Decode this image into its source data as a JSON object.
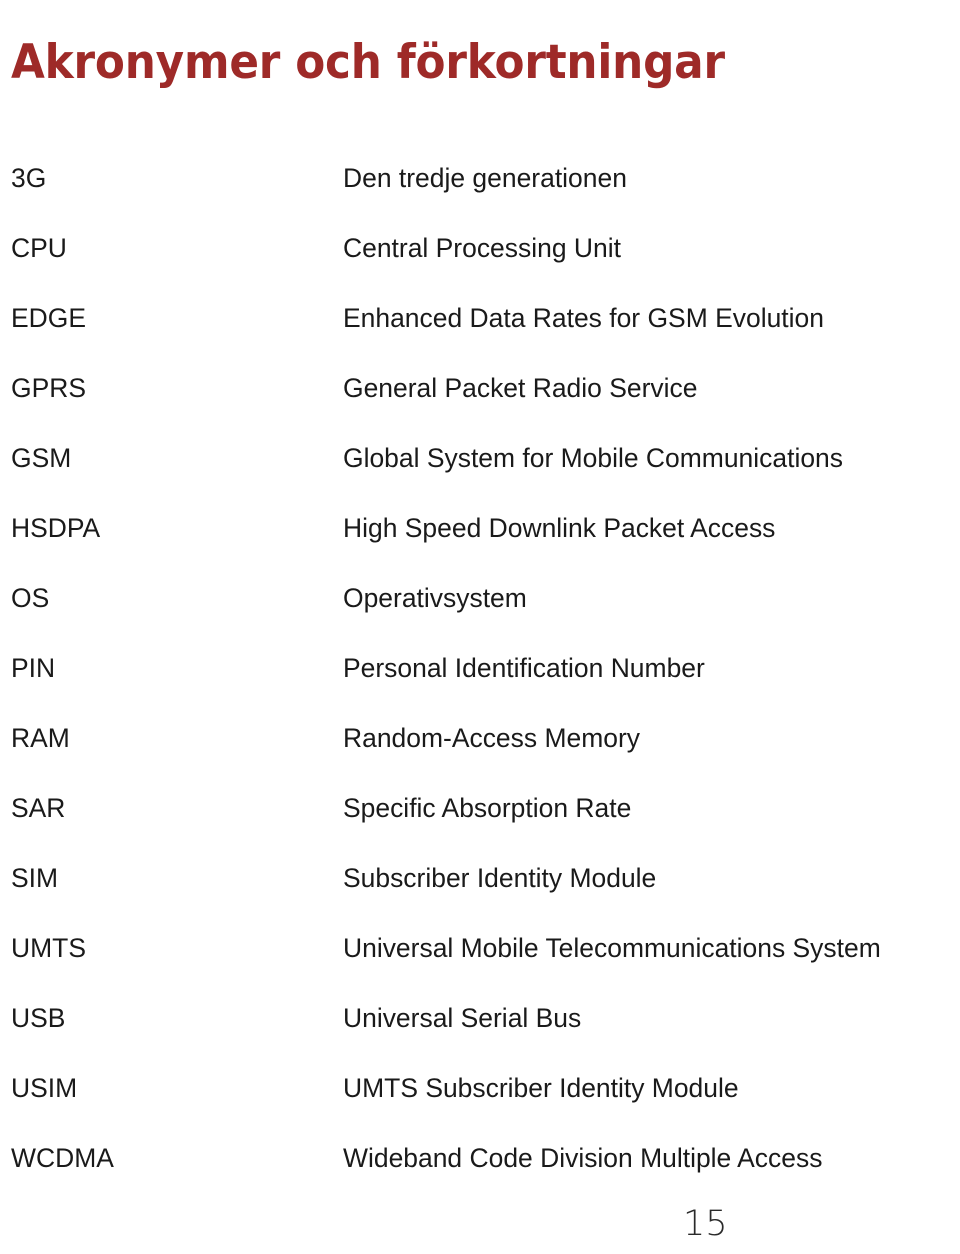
{
  "document": {
    "title": "Akronymer och förkortningar",
    "title_color": "#9e2a28",
    "body_color": "#1a1a1a",
    "page_number": "15"
  },
  "glossary": {
    "rows": [
      {
        "term": "3G",
        "definition": "Den tredje generationen"
      },
      {
        "term": "CPU",
        "definition": "Central Processing Unit"
      },
      {
        "term": "EDGE",
        "definition": "Enhanced Data Rates for GSM Evolution"
      },
      {
        "term": "GPRS",
        "definition": "General Packet Radio Service"
      },
      {
        "term": "GSM",
        "definition": "Global System for Mobile Communications"
      },
      {
        "term": "HSDPA",
        "definition": "High Speed Downlink Packet Access"
      },
      {
        "term": "OS",
        "definition": "Operativsystem"
      },
      {
        "term": "PIN",
        "definition": "Personal Identification Number"
      },
      {
        "term": "RAM",
        "definition": "Random-Access Memory"
      },
      {
        "term": "SAR",
        "definition": "Specific Absorption Rate"
      },
      {
        "term": "SIM",
        "definition": "Subscriber Identity Module"
      },
      {
        "term": "UMTS",
        "definition": "Universal Mobile Telecommunications System"
      },
      {
        "term": "USB",
        "definition": "Universal Serial Bus"
      },
      {
        "term": "USIM",
        "definition": "UMTS Subscriber Identity Module"
      },
      {
        "term": "WCDMA",
        "definition": "Wideband Code Division Multiple Access"
      }
    ]
  }
}
